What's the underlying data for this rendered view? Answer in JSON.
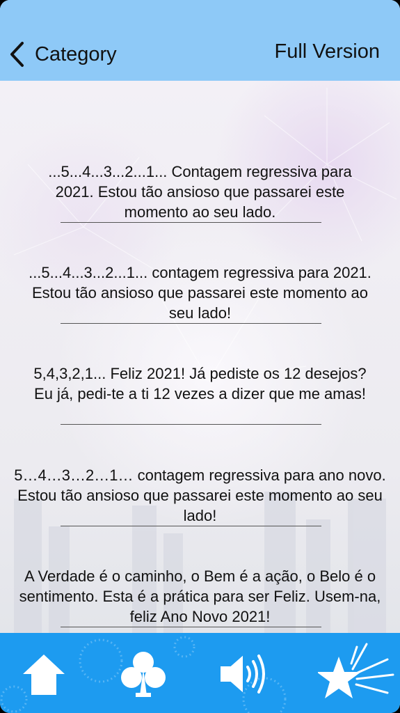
{
  "header": {
    "back_label": "Category",
    "right_label": "Full Version"
  },
  "messages": [
    {
      "text": "...5...4...3...2...1... Contagem regressiva para 2021. Estou tão ansioso que passarei este momento ao seu lado."
    },
    {
      "text": "...5...4...3...2...1... contagem regressiva para 2021. Estou tão ansioso que passarei este momento ao seu lado!"
    },
    {
      "text": "5,4,3,2,1... Feliz 2021! Já pediste os 12 desejos? Eu já, pedi-te a ti 12 vezes a dizer que me amas!"
    },
    {
      "text": "5…4…3…2…1… contagem regressiva para ano novo. Estou tão ansioso que passarei este momento ao seu lado!"
    },
    {
      "text": "A Verdade é o caminho, o Bem é a ação, o Belo é o sentimento. Esta é a prática para ser Feliz. Usem-na, feliz Ano Novo 2021!"
    }
  ],
  "tabbar": {
    "icons": [
      "home-icon",
      "club-icon",
      "speaker-icon",
      "star-icon"
    ]
  },
  "colors": {
    "header_bg": "#8ec9f7",
    "tabbar_bg": "#1d9bf0",
    "icon_fill": "#ffffff"
  }
}
